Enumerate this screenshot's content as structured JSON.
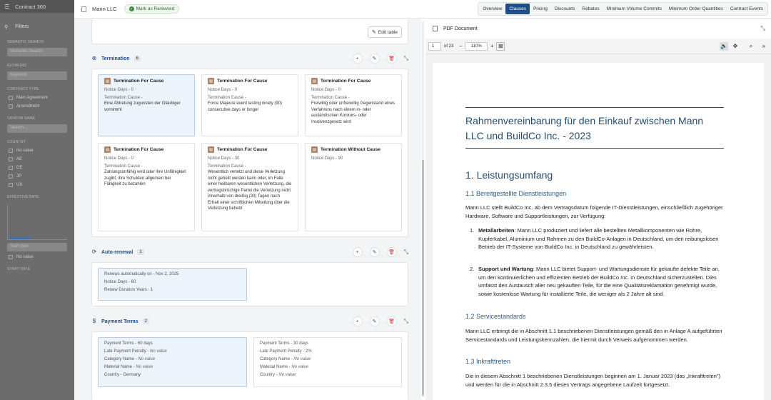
{
  "sidebar": {
    "app_title": "Contract 360",
    "filters_label": "Filters",
    "semantic_search_label": "SEMANTIC SEARCH",
    "semantic_search_placeholder": "Semantic Search",
    "keyword_label": "KEYWORD",
    "keyword_placeholder": "Keyword",
    "contract_type_label": "CONTRACT TYPE",
    "contract_types": [
      "Main Agreement",
      "Amendment"
    ],
    "vendor_label": "VENDOR NAME",
    "vendor_placeholder": "Search...",
    "country_label": "COUNTRY",
    "countries": [
      "No value",
      "AE",
      "DE",
      "JP",
      "US"
    ],
    "effective_date_label": "EFFECTIVE DATE",
    "start_date_placeholder": "Start date",
    "no_value": "No value",
    "start_date_label": "START DATE"
  },
  "header": {
    "company": "Mann LLC",
    "review_status": "Mark as Reviewed",
    "tabs": [
      "Overview",
      "Clauses",
      "Pricing",
      "Discounts",
      "Rebates",
      "Minimum Volume Commits",
      "Minimum Order Quantities",
      "Contract Events"
    ],
    "active_tab": "Clauses"
  },
  "clauses_panel": {
    "edit_table_label": "Edit table",
    "termination": {
      "title": "Termination",
      "count": "6",
      "cards": [
        {
          "title": "Termination For Cause",
          "notice_days": "Notice Days - 0",
          "cause_label": "Termination Cause -",
          "cause": "Eine Abtretung zugunsten der Gläubiger vornimmt"
        },
        {
          "title": "Termination For Cause",
          "notice_days": "Notice Days - 0",
          "cause_label": "Termination Cause -",
          "cause": "Force Majeure event lasting ninety (90) consecutive days or longer"
        },
        {
          "title": "Termination For Cause",
          "notice_days": "Notice Days - 0",
          "cause_label": "Termination Cause -",
          "cause": "Freiwillig oder unfreiwillig Gegenstand eines Verfahrens nach einem in- oder ausländischen Konkurs- oder Insolvenzgesetz wird"
        },
        {
          "title": "Termination For Cause",
          "notice_days": "Notice Days - 0",
          "cause_label": "Termination Cause -",
          "cause": "Zahlungsunfähig wird oder ihre Unfähigkeit zugibt, ihre Schulden allgemein bei Fälligkeit zu bezahlen"
        },
        {
          "title": "Termination For Cause",
          "notice_days": "Notice Days - 30",
          "cause_label": "Termination Cause -",
          "cause": "Wesentlich verletzt und diese Verletzung nicht geheilt werden kann oder, im Falle einer heilbaren wesentlichen Verletzung, die vertragsbrüchige Partei die Verletzung nicht innerhalb von dreißig (30) Tagen nach Erhalt einer schriftlichen Mitteilung über die Verletzung behebt"
        },
        {
          "title": "Termination Without Cause",
          "notice_days": "Notice Days - 90",
          "cause_label": "",
          "cause": ""
        }
      ]
    },
    "auto_renewal": {
      "title": "Auto-renewal",
      "count": "1",
      "lines": [
        "Renews automatically on - Nov 2, 2025",
        "Notice Days - 60",
        "Renew Duration Years - 1"
      ]
    },
    "payment_terms": {
      "title": "Payment Terms",
      "count": "2",
      "cards": [
        {
          "terms": "Payment Terms - 60 days",
          "late_label": "Late Payment Penalty -",
          "late_value": "No value",
          "category_label": "Category Name -",
          "category_value": "No value",
          "material_label": "Material Name -",
          "material_value": "No value",
          "country_label": "Country -",
          "country_value": "Germany"
        },
        {
          "terms": "Payment Terms - 30 days",
          "late_label": "Late Payment Penalty -",
          "late_value": "2%",
          "category_label": "Category Name -",
          "category_value": "No value",
          "material_label": "Material Name -",
          "material_value": "No value",
          "country_label": "Country -",
          "country_value": "No value"
        }
      ]
    }
  },
  "pdf": {
    "title": "PDF Document",
    "page": "1",
    "of_pages": "of 23",
    "zoom": "110%",
    "doc_title": "Rahmenvereinbarung für den Einkauf zwischen Mann LLC und BuildCo Inc. - 2023",
    "section1": "1. Leistungsumfang",
    "sub11": "1.1 Bereitgestellte Dienstleistungen",
    "p11": "Mann LLC stellt BuildCo Inc. ab dem Vertragsdatum folgende IT-Dienstleistungen, einschließlich zugehöriger Hardware, Software und Supportleistungen, zur Verfügung:",
    "item1_bold": "Metallarbeiten",
    "item1_text": ": Mann LLC produziert und liefert alle bestellten Metallkomponenten wie Rohre, Kupferkabel, Aluminium und Rahmen zu den BuildCo-Anlagen in Deutschland, um den reibungslosen Betrieb der IT-Systeme von BuildCo Inc. in Deutschland zu gewährleisten.",
    "item2_bold": "Support und Wartung",
    "item2_text": ": Mann LLC bietet Support- und Wartungsdienste für gekaufte defekte Teile an, um den kontinuierlichen und effizienten Betrieb der BuildCo Inc. in Deutschland sicherzustellen. Dies umfasst den Austausch aller neu gekauften Teile, für die eine Qualitätsreklamation genehmigt wurde, sowie kostenlose Wartung für installierte Teile, die weniger als 2 Jahre alt sind.",
    "sub12": "1.2 Servicestandards",
    "p12": "Mann LLC erbringt die in Abschnitt 1.1 beschriebenen Dienstleistungen gemäß den in Anlage A aufgeführten Servicestandards und Leistungskennzahlen, die hiermit durch Verweis aufgenommen werden.",
    "sub13": "1.3 Inkrafttreten",
    "p13": "Die in diesem Abschnitt 1 beschriebenen Dienstleistungen beginnen am 1. Januar 2023 (das „Inkrafttreten\") und werden für die in Abschnitt 2.3.5 dieses Vertrags angegebene Laufzeit fortgesetzt."
  }
}
